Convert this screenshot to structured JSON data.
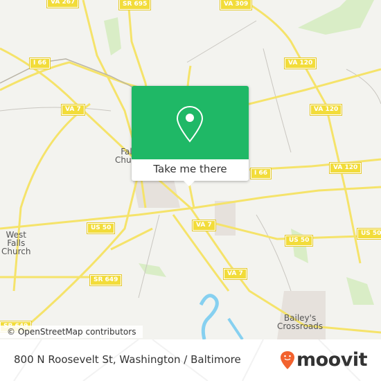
{
  "map": {
    "shields": [
      {
        "label": "VA 267"
      },
      {
        "label": "SR 695"
      },
      {
        "label": "VA 309"
      },
      {
        "label": "I 66"
      },
      {
        "label": "VA 120"
      },
      {
        "label": "VA 7"
      },
      {
        "label": "VA 120"
      },
      {
        "label": "VA 120"
      },
      {
        "label": "I 66"
      },
      {
        "label": "US 50"
      },
      {
        "label": "VA 7"
      },
      {
        "label": "US 50"
      },
      {
        "label": "US 50"
      },
      {
        "label": "SR 649"
      },
      {
        "label": "VA 7"
      },
      {
        "label": "SR 649"
      }
    ],
    "places": {
      "west_falls_church": "West\nFalls\nChurch",
      "falls_church": "Falls\nChurch",
      "baileys": "Bailey's\nCrossroads"
    },
    "attribution": "© OpenStreetMap contributors",
    "colors": {
      "road": "#f5e36a",
      "water": "#86d0f0",
      "park": "#d4ecc0",
      "popup": "#1fb866"
    }
  },
  "popup": {
    "icon": "map-pin-icon",
    "button_label": "Take me there"
  },
  "footer": {
    "address": "800 N Roosevelt St, Washington / Baltimore",
    "brand": "moovit"
  }
}
